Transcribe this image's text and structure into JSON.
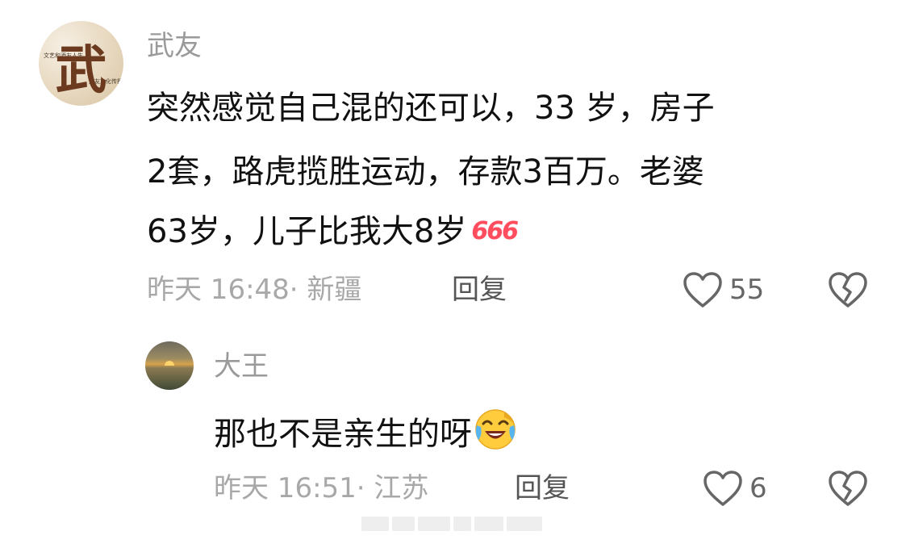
{
  "comment": {
    "username": "武友",
    "avatar_text": "武",
    "avatar_small_text_left": "文艺和酒友人生",
    "avatar_small_text_right": "武友文化传播",
    "lines": [
      "突然感觉自己混的还可以，33 岁，房子",
      "2套，路虎揽胜运动，存款3百万。老婆",
      "63岁，儿子比我大8岁"
    ],
    "badge": "666",
    "time": "昨天 16:48",
    "location": "· 新疆",
    "reply_label": "回复",
    "likes": "55",
    "like_icon": "heart-outline-icon",
    "dislike_icon": "broken-heart-icon"
  },
  "reply": {
    "username": "大王",
    "text": "那也不是亲生的呀",
    "emoji": "laughing-crying-emoji",
    "time": "昨天 16:51",
    "location": "· 江苏",
    "reply_label": "回复",
    "likes": "6"
  },
  "colors": {
    "meta_gray": "#a8a8a8",
    "text_dark": "#111111",
    "badge_red": "#ff4d5e"
  }
}
